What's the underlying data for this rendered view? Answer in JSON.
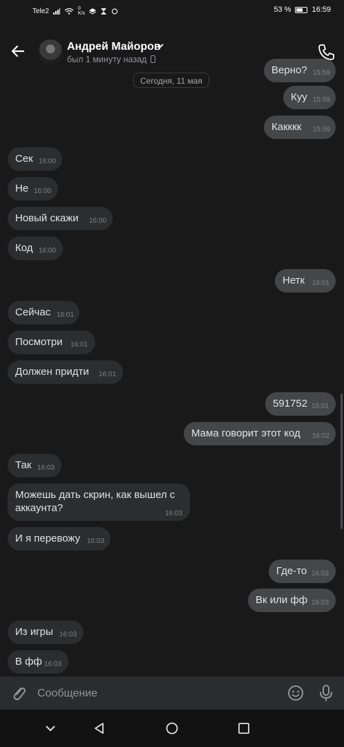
{
  "status": {
    "carrier": "Tele2",
    "speed": "0\nK/s",
    "battery_percent": "53 %",
    "battery_level": 0.53,
    "time": "16:59"
  },
  "header": {
    "contact_name": "Андрей Майоров",
    "last_seen": "был 1 минуту назад"
  },
  "date_separator": "Сегодня, 11 мая",
  "messages": [
    {
      "text": "Верно?",
      "time": "15:59",
      "dir": "out"
    },
    {
      "text": "Куу",
      "time": "15:59",
      "dir": "out"
    },
    {
      "text": "Какккк",
      "time": "15:59",
      "dir": "out"
    },
    {
      "text": "Сек",
      "time": "16:00",
      "dir": "in"
    },
    {
      "text": "Не",
      "time": "16:00",
      "dir": "in"
    },
    {
      "text": "Новый скажи",
      "time": "16:00",
      "dir": "in"
    },
    {
      "text": "Код",
      "time": "16:00",
      "dir": "in"
    },
    {
      "text": "Нетк",
      "time": "16:01",
      "dir": "out"
    },
    {
      "text": "Сейчас",
      "time": "16:01",
      "dir": "in"
    },
    {
      "text": "Посмотри",
      "time": "16:01",
      "dir": "in"
    },
    {
      "text": "Должен придти",
      "time": "16:01",
      "dir": "in"
    },
    {
      "text": "591752",
      "time": "16:01",
      "dir": "out"
    },
    {
      "text": "Мама говорит этот код",
      "time": "16:02",
      "dir": "out"
    },
    {
      "text": "Так",
      "time": "16:03",
      "dir": "in"
    },
    {
      "text": "Можешь дать скрин, как вышел с аккаунта?",
      "time": "16:03",
      "dir": "in"
    },
    {
      "text": "И я перевожу",
      "time": "16:03",
      "dir": "in"
    },
    {
      "text": "Где-то",
      "time": "16:03",
      "dir": "out"
    },
    {
      "text": "Вк или фф",
      "time": "16:03",
      "dir": "out"
    },
    {
      "text": "Из игры",
      "time": "16:03",
      "dir": "in"
    },
    {
      "text": "В фф",
      "time": "16:03",
      "dir": "in"
    }
  ],
  "composer": {
    "placeholder": "Сообщение"
  },
  "icons": [
    "back-arrow-icon",
    "chevron-down-icon",
    "phone-call-icon",
    "paperclip-icon",
    "emoji-icon",
    "microphone-icon",
    "nav-back-icon",
    "nav-home-icon",
    "nav-recents-icon",
    "nav-hide-icon"
  ]
}
